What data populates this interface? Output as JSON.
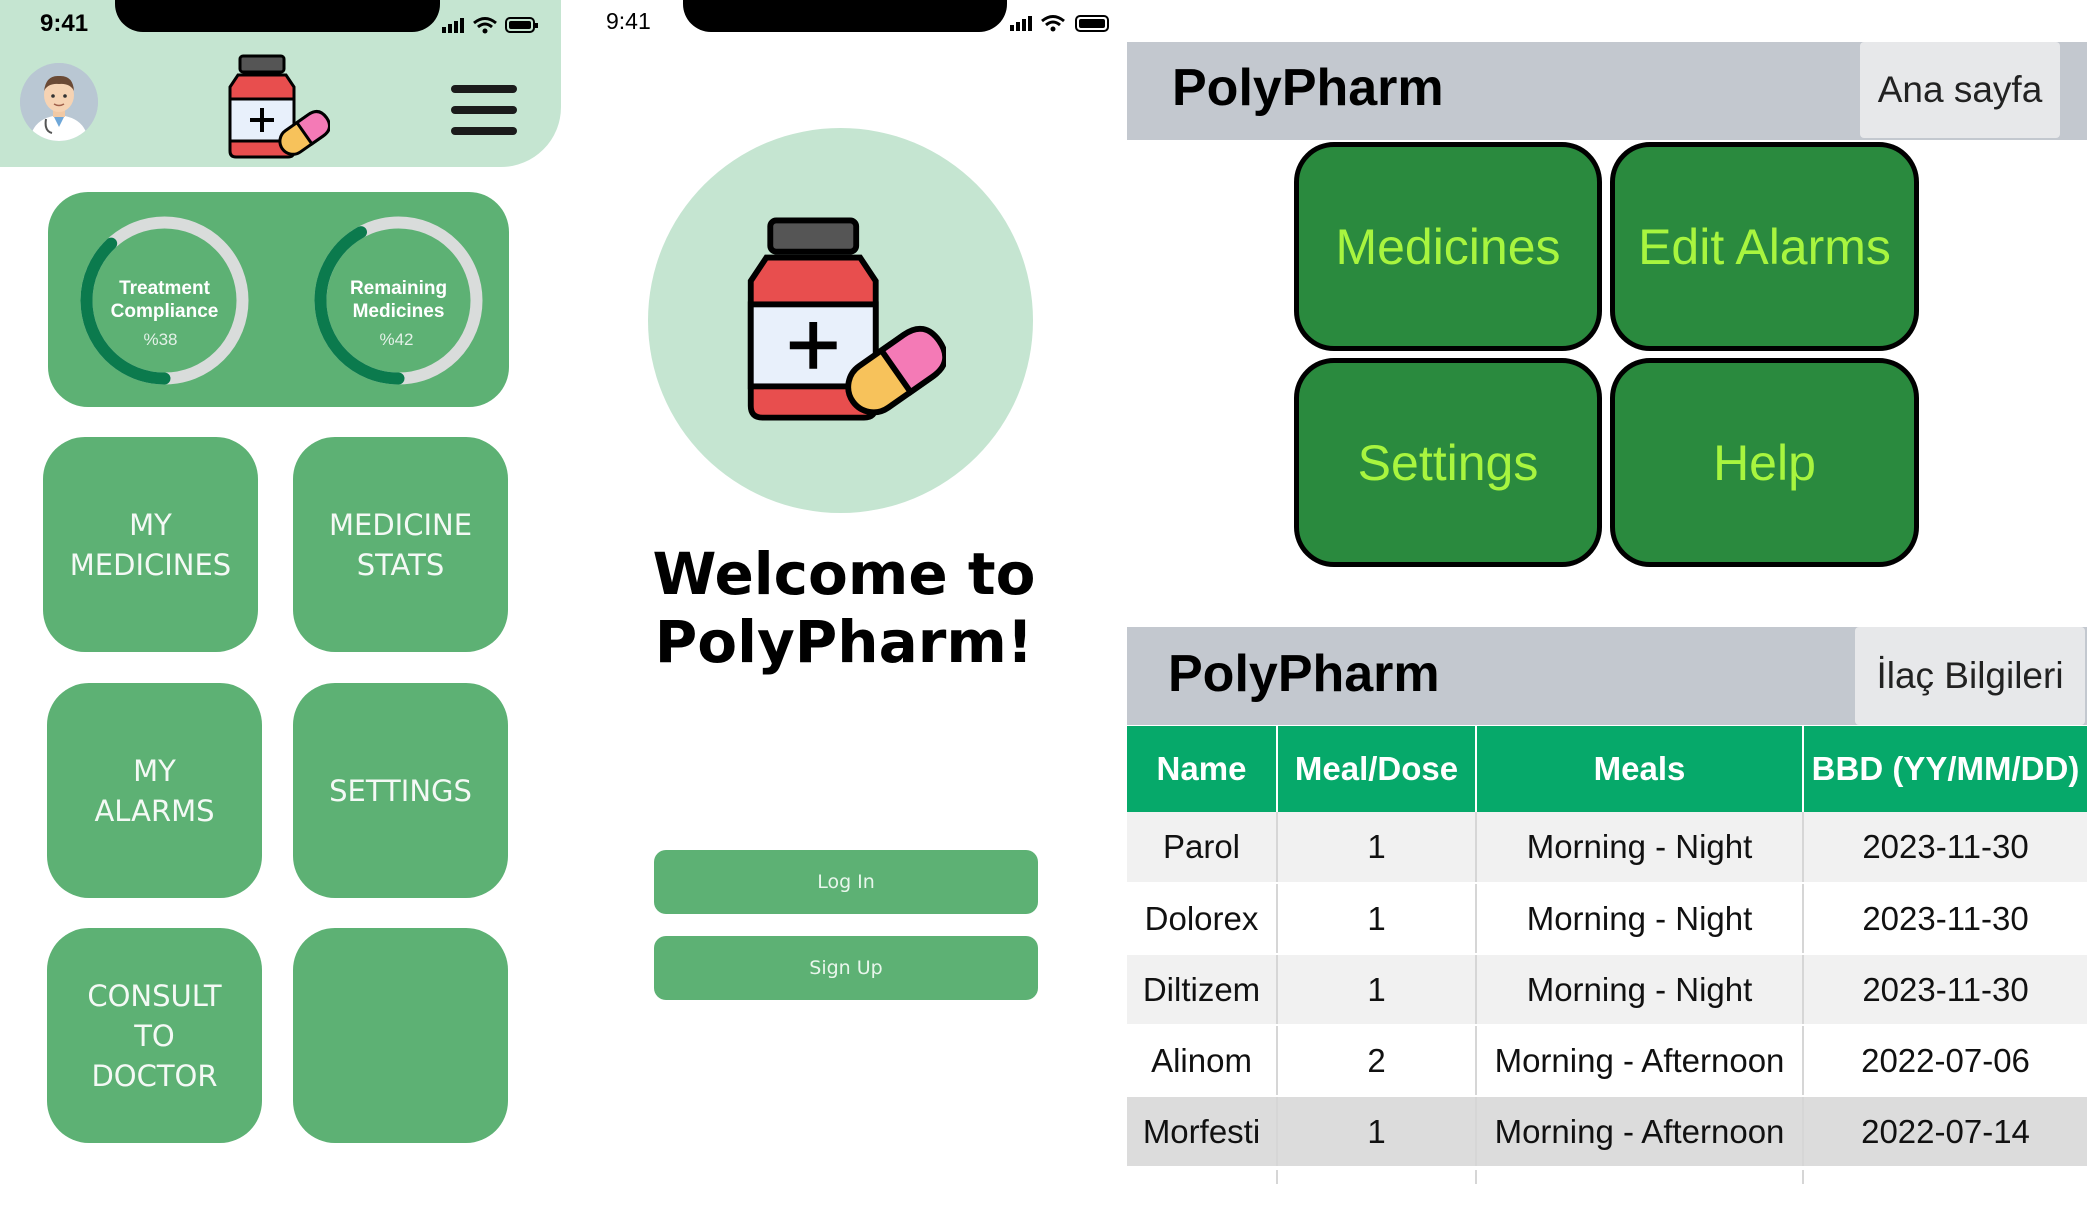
{
  "status_bar": {
    "time": "9:41"
  },
  "colors": {
    "app_green": "#5db174",
    "header_mint": "#c5e5d1",
    "dark_green_button": "#2a8a3e",
    "button_text_lime": "#a8f53f",
    "table_header_green": "#06a96a",
    "topbar_gray": "#c3c8cf"
  },
  "dashboard": {
    "icons": {
      "avatar": "doctor-avatar",
      "logo": "medicine-bottle-pill-logo",
      "menu": "hamburger-menu-icon"
    },
    "stats": [
      {
        "label": "Treatment\nCompliance",
        "value": "%38",
        "progress": 0.38
      },
      {
        "label": "Remaining\nMedicines",
        "value": "%42",
        "progress": 0.42
      }
    ],
    "tiles": [
      {
        "label": "MY\nMEDICINES"
      },
      {
        "label": "MEDICINE\nSTATS"
      },
      {
        "label": "MY\nALARMS"
      },
      {
        "label": "SETTINGS"
      },
      {
        "label": "CONSULT\nTO\nDOCTOR"
      },
      {
        "label": ""
      }
    ]
  },
  "welcome": {
    "title": "Welcome to\nPolyPharm!",
    "login_label": "Log In",
    "signup_label": "Sign Up"
  },
  "home": {
    "brand": "PolyPharm",
    "nav_button": "Ana sayfa",
    "buttons": [
      "Medicines",
      "Edit Alarms",
      "Settings",
      "Help"
    ]
  },
  "medicine_info": {
    "brand": "PolyPharm",
    "nav_button": "İlaç Bilgileri",
    "columns": [
      "Name",
      "Meal/Dose",
      "Meals",
      "BBD (YY/MM/DD)"
    ],
    "rows": [
      [
        "Parol",
        "1",
        "Morning - Night",
        "2023-11-30"
      ],
      [
        "Dolorex",
        "1",
        "Morning - Night",
        "2023-11-30"
      ],
      [
        "Diltizem",
        "1",
        "Morning - Night",
        "2023-11-30"
      ],
      [
        "Alinom",
        "2",
        "Morning - Afternoon",
        "2022-07-06"
      ],
      [
        "Morfesti",
        "1",
        "Morning - Afternoon",
        "2022-07-14"
      ]
    ]
  }
}
